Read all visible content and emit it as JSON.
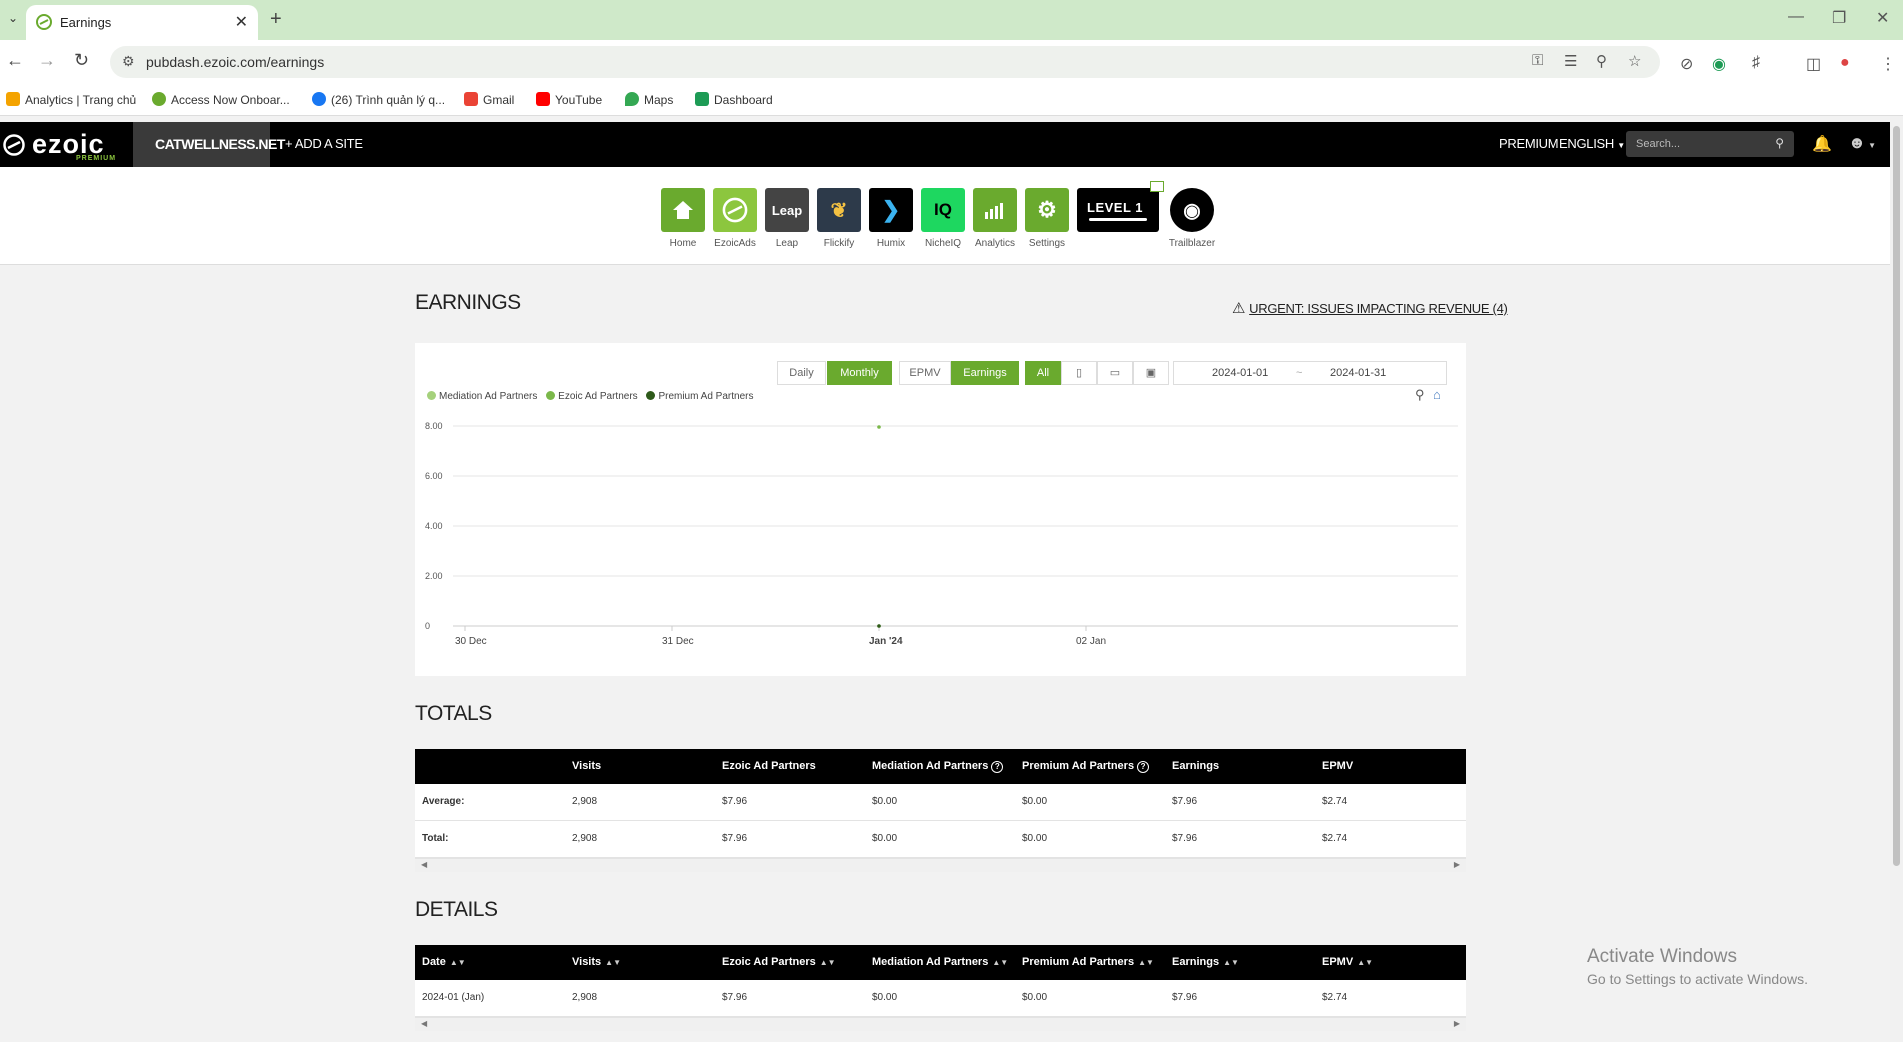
{
  "browser": {
    "tab_title": "Earnings",
    "url": "pubdash.ezoic.com/earnings",
    "bookmarks": [
      {
        "label": "Analytics | Trang chủ",
        "color": "#f4a300"
      },
      {
        "label": "Access Now Onboar...",
        "color": "#6aaa2e"
      },
      {
        "label": "(26) Trình quản lý q...",
        "color": "#1877f2"
      },
      {
        "label": "Gmail",
        "color": "#ea4335"
      },
      {
        "label": "YouTube",
        "color": "#ff0000"
      },
      {
        "label": "Maps",
        "color": "#34a853"
      },
      {
        "label": "Dashboard",
        "color": "#1d9b55"
      }
    ]
  },
  "header": {
    "logo": "ezoic",
    "logo_sub": "PREMIUM",
    "site": "CATWELLNESS.NET",
    "add_site": "+ ADD A SITE",
    "premium": "PREMIUM",
    "language": "ENGLISH",
    "search_placeholder": "Search..."
  },
  "apps": [
    {
      "label": "Home",
      "icon": "home-icon",
      "color": "#6aaa2e"
    },
    {
      "label": "EzoicAds",
      "icon": "ezoic-icon",
      "color": "#8cc63e"
    },
    {
      "label": "Leap",
      "icon": "leap-icon",
      "color": "#444444",
      "text": "Leap"
    },
    {
      "label": "Flickify",
      "icon": "flickify-icon",
      "color": "#2d3a4a"
    },
    {
      "label": "Humix",
      "icon": "humix-icon",
      "color": "#000000"
    },
    {
      "label": "NicheIQ",
      "icon": "nicheiq-icon",
      "color": "#1ed760",
      "text": "IQ"
    },
    {
      "label": "Analytics",
      "icon": "analytics-icon",
      "color": "#6aaa2e"
    },
    {
      "label": "Settings",
      "icon": "settings-icon",
      "color": "#6aaa2e"
    },
    {
      "label": "Trailblazer",
      "icon": "trailblazer-icon",
      "color": "#000000"
    }
  ],
  "level": "LEVEL 1",
  "earnings": {
    "title": "EARNINGS",
    "urgent": "URGENT: ISSUES IMPACTING REVENUE (4)",
    "buttons": {
      "daily": "Daily",
      "monthly": "Monthly",
      "epmv": "EPMV",
      "earnings": "Earnings",
      "all": "All"
    },
    "date_from": "2024-01-01",
    "date_sep": "~",
    "date_to": "2024-01-31"
  },
  "chart_data": {
    "type": "line",
    "series": [
      {
        "name": "Mediation Ad Partners",
        "color": "#a5d17c",
        "values": [
          0
        ]
      },
      {
        "name": "Ezoic Ad Partners",
        "color": "#7bb84a",
        "values": [
          7.96
        ]
      },
      {
        "name": "Premium Ad Partners",
        "color": "#2e5a1a",
        "values": [
          0
        ]
      }
    ],
    "x_ticks": [
      "30 Dec",
      "31 Dec",
      "Jan '24",
      "02 Jan"
    ],
    "x_point_index": 2,
    "y_ticks": [
      "0",
      "2.00",
      "4.00",
      "6.00",
      "8.00"
    ],
    "ylim": [
      0,
      8
    ]
  },
  "totals": {
    "title": "TOTALS",
    "columns": [
      "",
      "Visits",
      "Ezoic Ad Partners",
      "Mediation Ad Partners",
      "Premium Ad Partners",
      "Earnings",
      "EPMV"
    ],
    "rows": [
      [
        "Average:",
        "2,908",
        "$7.96",
        "$0.00",
        "$0.00",
        "$7.96",
        "$2.74"
      ],
      [
        "Total:",
        "2,908",
        "$7.96",
        "$0.00",
        "$0.00",
        "$7.96",
        "$2.74"
      ]
    ]
  },
  "details": {
    "title": "DETAILS",
    "columns": [
      "Date",
      "Visits",
      "Ezoic Ad Partners",
      "Mediation Ad Partners",
      "Premium Ad Partners",
      "Earnings",
      "EPMV"
    ],
    "rows": [
      [
        "2024-01 (Jan)",
        "2,908",
        "$7.96",
        "$0.00",
        "$0.00",
        "$7.96",
        "$2.74"
      ]
    ]
  },
  "watermark": {
    "line1": "Activate Windows",
    "line2": "Go to Settings to activate Windows."
  }
}
